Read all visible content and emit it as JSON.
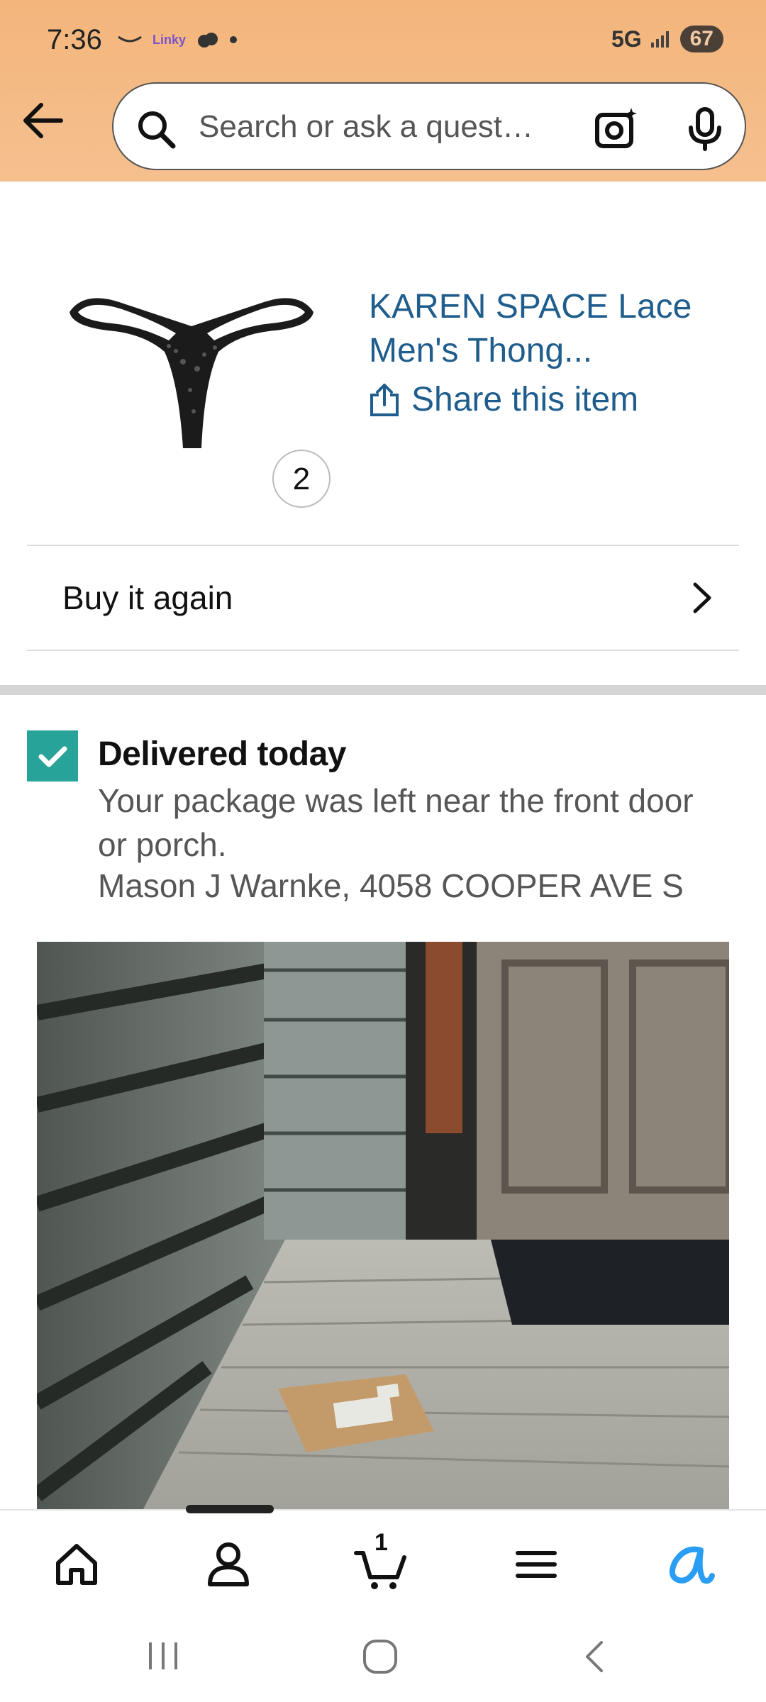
{
  "status_bar": {
    "time": "7:36",
    "app_badge": "Linky",
    "network": "5G",
    "battery": "67"
  },
  "search": {
    "placeholder": "Search or ask a quest…"
  },
  "product": {
    "title": "KAREN SPACE Lace Men's Thong...",
    "quantity": "2",
    "share_label": "Share this item"
  },
  "buy_again": {
    "label": "Buy it again"
  },
  "delivery": {
    "status": "Delivered today",
    "message": "Your package was left near the front door or porch.",
    "address": "Mason J Warnke, 4058 COOPER AVE S"
  },
  "bottom_nav": {
    "items": [
      "home-icon",
      "account-icon",
      "cart-icon",
      "menu-icon",
      "rufus-icon"
    ],
    "cart_count": "1"
  },
  "system_nav": [
    "recents",
    "home",
    "back"
  ],
  "colors": {
    "header_bg": "#f3b57b",
    "link_blue": "#1f5d8c",
    "check_teal": "#27a39a",
    "rufus_blue": "#2a9df4"
  }
}
